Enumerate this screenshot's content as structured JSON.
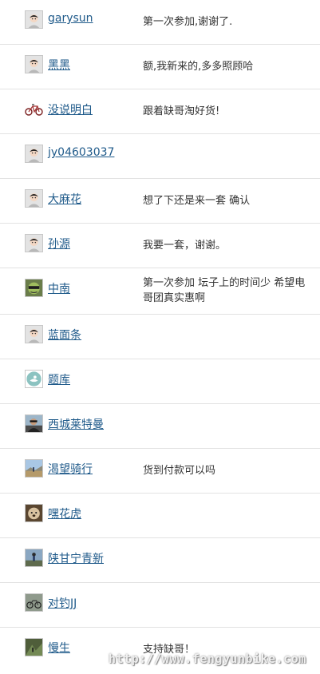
{
  "rows": [
    {
      "user": "garysun",
      "comment": "第一次参加,谢谢了.",
      "avatar": "default-avatar-icon"
    },
    {
      "user": "黑黑",
      "comment": "额,我新来的,多多照顾哈",
      "avatar": "default-avatar-icon"
    },
    {
      "user": "没说明白",
      "comment": "跟着缺哥淘好货!",
      "avatar": "bicycle-avatar-icon"
    },
    {
      "user": "jy04603037",
      "comment": "",
      "avatar": "default-avatar-icon"
    },
    {
      "user": "大麻花",
      "comment": "想了下还是来一套 确认",
      "avatar": "default-avatar-icon"
    },
    {
      "user": "孙源",
      "comment": "我要一套，谢谢。",
      "avatar": "default-avatar-icon"
    },
    {
      "user": "中南",
      "comment": "第一次参加 坛子上的时间少 希望电",
      "comment2": "哥团真实惠啊",
      "avatar": "cartoon-face-avatar-icon"
    },
    {
      "user": "蓝面条",
      "comment": "",
      "avatar": "default-avatar-icon"
    },
    {
      "user": "题库",
      "comment": "",
      "avatar": "teal-circle-avatar-icon"
    },
    {
      "user": "西城莱特曼",
      "comment": "",
      "avatar": "rider-photo-avatar-icon"
    },
    {
      "user": "渴望骑行",
      "comment": "货到付款可以吗",
      "avatar": "landscape-photo-avatar-icon"
    },
    {
      "user": "嘿花虎",
      "comment": "",
      "avatar": "dog-photo-avatar-icon"
    },
    {
      "user": "陕甘宁青新",
      "comment": "",
      "avatar": "cyclist-photo-avatar-icon"
    },
    {
      "user": "对钓JJ",
      "comment": "",
      "avatar": "bike-photo-avatar-icon"
    },
    {
      "user": "慢生",
      "comment": "支持缺哥！",
      "avatar": "trail-photo-avatar-icon"
    }
  ],
  "watermark": "http://www.fengyunbike.com"
}
